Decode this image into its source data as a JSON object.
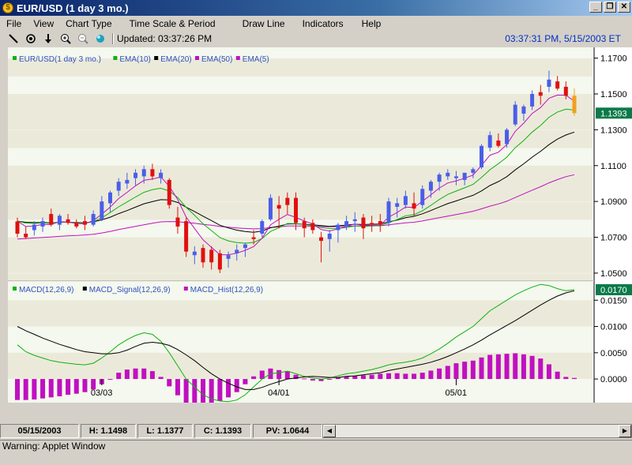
{
  "window": {
    "title": "EUR/USD (1 day  3 mo.)",
    "min": "_",
    "max": "❐",
    "close": "✕"
  },
  "menu": [
    "File",
    "View",
    "Chart Type",
    "Time Scale & Period",
    "Draw Line",
    "Indicators",
    "Help"
  ],
  "toolbar": {
    "updated": "Updated: 03:37:26 PM",
    "icons": [
      "draw-line-icon",
      "crosshair-icon",
      "down-arrow-icon",
      "zoom-in-icon",
      "zoom-out-icon",
      "globe-icon"
    ]
  },
  "clock": "03:37:31 PM, 5/15/2003 ET",
  "colors": {
    "up": "#4a5ee8",
    "down": "#e01010",
    "ema10": "#10b010",
    "ema20": "#000000",
    "ema50": "#c010c0",
    "ema5": "#c010c0",
    "last": "#f0a020",
    "axis_highlight": "#0a7a4a"
  },
  "chart_data": [
    {
      "type": "candlestick",
      "legend": [
        {
          "name": "EUR/USD(1 day  3 mo.)",
          "color": "#10b010"
        },
        {
          "name": "EMA(10)",
          "color": "#10b010"
        },
        {
          "name": "EMA(20)",
          "color": "#000000"
        },
        {
          "name": "EMA(50)",
          "color": "#c010c0"
        },
        {
          "name": "EMA(5)",
          "color": "#c010c0"
        }
      ],
      "yticks": [
        "1.1700",
        "1.1500",
        "1.1300",
        "1.1100",
        "1.0900",
        "1.0700",
        "1.0500"
      ],
      "ylim": [
        1.046,
        1.176
      ],
      "last_value": "1.1393",
      "xticks": [
        {
          "label": "03/03",
          "index": 10
        },
        {
          "label": "04/01",
          "index": 31
        },
        {
          "label": "05/01",
          "index": 52
        }
      ],
      "candles": [
        [
          1.0788,
          1.081,
          1.07,
          1.072
        ],
        [
          1.072,
          1.076,
          1.069,
          1.07
        ],
        [
          1.074,
          1.079,
          1.071,
          1.077
        ],
        [
          1.076,
          1.081,
          1.073,
          1.079
        ],
        [
          1.083,
          1.086,
          1.076,
          1.077
        ],
        [
          1.077,
          1.083,
          1.074,
          1.082
        ],
        [
          1.08,
          1.083,
          1.077,
          1.078
        ],
        [
          1.078,
          1.08,
          1.075,
          1.076
        ],
        [
          1.079,
          1.082,
          1.074,
          1.077
        ],
        [
          1.077,
          1.085,
          1.076,
          1.083
        ],
        [
          1.08,
          1.093,
          1.079,
          1.09
        ],
        [
          1.089,
          1.096,
          1.084,
          1.095
        ],
        [
          1.096,
          1.103,
          1.093,
          1.101
        ],
        [
          1.1,
          1.106,
          1.097,
          1.102
        ],
        [
          1.103,
          1.108,
          1.099,
          1.106
        ],
        [
          1.104,
          1.11,
          1.1,
          1.108
        ],
        [
          1.108,
          1.111,
          1.102,
          1.104
        ],
        [
          1.103,
          1.108,
          1.1,
          1.106
        ],
        [
          1.102,
          1.103,
          1.086,
          1.088
        ],
        [
          1.081,
          1.087,
          1.072,
          1.076
        ],
        [
          1.079,
          1.081,
          1.059,
          1.062
        ],
        [
          1.06,
          1.065,
          1.055,
          1.062
        ],
        [
          1.064,
          1.066,
          1.053,
          1.056
        ],
        [
          1.063,
          1.065,
          1.052,
          1.056
        ],
        [
          1.061,
          1.063,
          1.05,
          1.052
        ],
        [
          1.058,
          1.062,
          1.053,
          1.06
        ],
        [
          1.061,
          1.066,
          1.057,
          1.063
        ],
        [
          1.064,
          1.067,
          1.059,
          1.066
        ],
        [
          1.07,
          1.074,
          1.066,
          1.069
        ],
        [
          1.072,
          1.08,
          1.07,
          1.079
        ],
        [
          1.08,
          1.094,
          1.079,
          1.092
        ],
        [
          1.088,
          1.093,
          1.075,
          1.086
        ],
        [
          1.092,
          1.095,
          1.083,
          1.088
        ],
        [
          1.092,
          1.095,
          1.074,
          1.078
        ],
        [
          1.079,
          1.081,
          1.07,
          1.075
        ],
        [
          1.078,
          1.08,
          1.072,
          1.074
        ],
        [
          1.07,
          1.073,
          1.056,
          1.068
        ],
        [
          1.069,
          1.074,
          1.062,
          1.072
        ],
        [
          1.074,
          1.078,
          1.067,
          1.077
        ],
        [
          1.076,
          1.082,
          1.074,
          1.079
        ],
        [
          1.079,
          1.084,
          1.073,
          1.08
        ],
        [
          1.081,
          1.083,
          1.069,
          1.075
        ],
        [
          1.078,
          1.082,
          1.073,
          1.077
        ],
        [
          1.079,
          1.083,
          1.073,
          1.077
        ],
        [
          1.078,
          1.092,
          1.076,
          1.09
        ],
        [
          1.087,
          1.092,
          1.081,
          1.089
        ],
        [
          1.088,
          1.096,
          1.086,
          1.093
        ],
        [
          1.089,
          1.095,
          1.082,
          1.086
        ],
        [
          1.088,
          1.099,
          1.086,
          1.097
        ],
        [
          1.096,
          1.102,
          1.092,
          1.101
        ],
        [
          1.101,
          1.106,
          1.096,
          1.105
        ],
        [
          1.104,
          1.108,
          1.102,
          1.106
        ],
        [
          1.103,
          1.107,
          1.099,
          1.104
        ],
        [
          1.102,
          1.106,
          1.099,
          1.106
        ],
        [
          1.106,
          1.109,
          1.103,
          1.108
        ],
        [
          1.109,
          1.122,
          1.108,
          1.121
        ],
        [
          1.12,
          1.129,
          1.118,
          1.127
        ],
        [
          1.124,
          1.128,
          1.12,
          1.121
        ],
        [
          1.122,
          1.131,
          1.12,
          1.13
        ],
        [
          1.133,
          1.146,
          1.132,
          1.144
        ],
        [
          1.139,
          1.144,
          1.135,
          1.143
        ],
        [
          1.143,
          1.152,
          1.141,
          1.15
        ],
        [
          1.151,
          1.155,
          1.144,
          1.149
        ],
        [
          1.154,
          1.163,
          1.151,
          1.158
        ],
        [
          1.157,
          1.16,
          1.152,
          1.153
        ],
        [
          1.154,
          1.157,
          1.147,
          1.149
        ],
        [
          1.149,
          1.153,
          1.1377,
          1.1393
        ]
      ],
      "ema10": [
        1.079,
        1.0779,
        1.0777,
        1.078,
        1.0778,
        1.0785,
        1.0784,
        1.078,
        1.0779,
        1.0787,
        1.0808,
        1.0838,
        1.087,
        1.0897,
        1.0925,
        1.0951,
        1.0966,
        1.0974,
        1.0958,
        1.0922,
        1.0867,
        1.0823,
        1.0775,
        1.0737,
        1.0698,
        1.068,
        1.067,
        1.0667,
        1.0671,
        1.0693,
        1.0733,
        1.0753,
        1.0777,
        1.0776,
        1.0772,
        1.0766,
        1.0754,
        1.0749,
        1.075,
        1.0755,
        1.0763,
        1.0761,
        1.0763,
        1.0765,
        1.0781,
        1.0799,
        1.082,
        1.0826,
        1.0848,
        1.0878,
        1.0911,
        1.0939,
        1.0958,
        1.0976,
        1.0995,
        1.1034,
        1.1077,
        1.1111,
        1.1147,
        1.12,
        1.124,
        1.1287,
        1.1324,
        1.137,
        1.1399,
        1.1415,
        1.141
      ],
      "ema20": [
        1.079,
        1.0784,
        1.0782,
        1.0782,
        1.0781,
        1.0784,
        1.0784,
        1.0782,
        1.0781,
        1.0786,
        1.0797,
        1.0812,
        1.0832,
        1.0849,
        1.0868,
        1.0887,
        1.0899,
        1.091,
        1.0908,
        1.0894,
        1.0868,
        1.0844,
        1.0818,
        1.0793,
        1.0767,
        1.0752,
        1.074,
        1.0732,
        1.0728,
        1.0735,
        1.0753,
        1.0762,
        1.0774,
        1.0775,
        1.0773,
        1.077,
        1.0765,
        1.0761,
        1.0764,
        1.0768,
        1.0773,
        1.0771,
        1.0773,
        1.0774,
        1.0786,
        1.0796,
        1.0809,
        1.0817,
        1.0831,
        1.0849,
        1.0869,
        1.0888,
        1.0903,
        1.0919,
        1.0934,
        1.0959,
        1.0989,
        1.1011,
        1.1038,
        1.1076,
        1.111,
        1.1147,
        1.118,
        1.1217,
        1.1248,
        1.1271,
        1.1287
      ],
      "ema50": [
        1.069,
        1.0693,
        1.0696,
        1.0699,
        1.0702,
        1.0705,
        1.0708,
        1.071,
        1.0713,
        1.0717,
        1.0724,
        1.0733,
        1.0743,
        1.0752,
        1.0761,
        1.077,
        1.0778,
        1.0786,
        1.0788,
        1.0787,
        1.0782,
        1.0778,
        1.0772,
        1.0767,
        1.076,
        1.0756,
        1.0752,
        1.0749,
        1.0747,
        1.0748,
        1.0755,
        1.0758,
        1.0763,
        1.0763,
        1.0763,
        1.0762,
        1.076,
        1.0759,
        1.076,
        1.0761,
        1.0763,
        1.0763,
        1.0764,
        1.0764,
        1.077,
        1.0775,
        1.0781,
        1.0784,
        1.0791,
        1.08,
        1.0809,
        1.0818,
        1.0827,
        1.0836,
        1.0845,
        1.0859,
        1.0874,
        1.0886,
        1.0901,
        1.0922,
        1.0942,
        1.0963,
        1.0982,
        1.1004,
        1.1022,
        1.1038,
        1.1049
      ],
      "ema5": [
        1.079,
        1.076,
        1.0763,
        1.0772,
        1.0771,
        1.0787,
        1.0785,
        1.0777,
        1.0775,
        1.0793,
        1.0829,
        1.0869,
        1.0916,
        1.0951,
        1.0987,
        1.1018,
        1.1025,
        1.1037,
        1.0985,
        1.091,
        1.0813,
        1.0749,
        1.0686,
        1.0644,
        1.0603,
        1.0602,
        1.0611,
        1.0627,
        1.0648,
        1.0695,
        1.077,
        1.08,
        1.0827,
        1.0811,
        1.0791,
        1.0774,
        1.0743,
        1.0735,
        1.0747,
        1.0761,
        1.0774,
        1.0766,
        1.0767,
        1.0768,
        1.0812,
        1.0838,
        1.0869,
        1.0866,
        1.0901,
        1.0937,
        1.0975,
        1.1003,
        1.1015,
        1.103,
        1.1047,
        1.1101,
        1.1158,
        1.1175,
        1.1217,
        1.1291,
        1.1337,
        1.1391,
        1.1424,
        1.1476,
        1.1494,
        1.1493,
        1.146
      ]
    },
    {
      "type": "macd",
      "legend": [
        {
          "name": "MACD(12,26,9)",
          "color": "#10b010"
        },
        {
          "name": "MACD_Signal(12,26,9)",
          "color": "#000000"
        },
        {
          "name": "MACD_Hist(12,26,9)",
          "color": "#c010c0"
        }
      ],
      "yticks": [
        "0.0150",
        "0.0100",
        "0.0050",
        "0.0000"
      ],
      "ylim": [
        -0.0045,
        0.0185
      ],
      "last_value": "0.0170",
      "macd": [
        0.0065,
        0.0052,
        0.0045,
        0.004,
        0.0035,
        0.0032,
        0.003,
        0.0028,
        0.0027,
        0.003,
        0.004,
        0.0052,
        0.0065,
        0.0075,
        0.0083,
        0.0088,
        0.0085,
        0.0072,
        0.005,
        0.0025,
        0.0,
        -0.0015,
        -0.003,
        -0.0038,
        -0.0042,
        -0.0043,
        -0.004,
        -0.003,
        -0.0015,
        0.0,
        0.001,
        0.0012,
        0.0015,
        0.001,
        0.0005,
        0.0002,
        0.0,
        0.0002,
        0.0006,
        0.001,
        0.0012,
        0.0015,
        0.0018,
        0.0022,
        0.0027,
        0.003,
        0.0032,
        0.0035,
        0.004,
        0.0048,
        0.0057,
        0.0068,
        0.008,
        0.009,
        0.01,
        0.0115,
        0.013,
        0.014,
        0.015,
        0.016,
        0.0168,
        0.0175,
        0.018,
        0.0178,
        0.0172,
        0.0168,
        0.017
      ],
      "signal": [
        0.01,
        0.0092,
        0.0085,
        0.0078,
        0.0072,
        0.0066,
        0.0061,
        0.0056,
        0.0052,
        0.005,
        0.0048,
        0.0048,
        0.005,
        0.0055,
        0.0062,
        0.0068,
        0.007,
        0.0068,
        0.0064,
        0.0056,
        0.0046,
        0.0035,
        0.0022,
        0.001,
        0.0,
        -0.0008,
        -0.0015,
        -0.002,
        -0.002,
        -0.0016,
        -0.001,
        -0.0005,
        0.0,
        0.0002,
        0.0004,
        0.0005,
        0.0004,
        0.0003,
        0.0003,
        0.0005,
        0.0006,
        0.0008,
        0.001,
        0.0012,
        0.0016,
        0.0019,
        0.0022,
        0.0025,
        0.0028,
        0.0032,
        0.0037,
        0.0043,
        0.005,
        0.0057,
        0.0065,
        0.0074,
        0.0084,
        0.0093,
        0.0102,
        0.0111,
        0.0121,
        0.0131,
        0.0141,
        0.015,
        0.0158,
        0.0164,
        0.0168
      ],
      "hist": [
        -0.004,
        -0.004,
        -0.0039,
        -0.0037,
        -0.0035,
        -0.0033,
        -0.003,
        -0.0028,
        -0.0025,
        -0.002,
        -0.001,
        0.0,
        0.0012,
        0.0018,
        0.002,
        0.002,
        0.0015,
        0.0004,
        -0.0014,
        -0.0031,
        -0.0045,
        -0.005,
        -0.0052,
        -0.0048,
        -0.0042,
        -0.0035,
        -0.0025,
        -0.001,
        0.0005,
        0.0016,
        0.002,
        0.0017,
        0.0015,
        0.0008,
        0.0001,
        -0.0003,
        -0.0004,
        -0.0001,
        0.0003,
        0.0005,
        0.0006,
        0.0007,
        0.0008,
        0.001,
        0.0011,
        0.0011,
        0.001,
        0.001,
        0.0012,
        0.0016,
        0.002,
        0.0025,
        0.003,
        0.0033,
        0.0035,
        0.0041,
        0.0046,
        0.0047,
        0.0048,
        0.0049,
        0.0047,
        0.0044,
        0.0039,
        0.0028,
        0.0014,
        0.0004,
        0.0002
      ]
    }
  ],
  "status": {
    "date": "05/15/2003",
    "high": "H: 1.1498",
    "low": "L: 1.1377",
    "close": "C: 1.1393",
    "pv": "PV: 1.0644"
  },
  "scroll": {
    "left": "◀",
    "right": "▶"
  },
  "warning": "Warning: Applet Window"
}
